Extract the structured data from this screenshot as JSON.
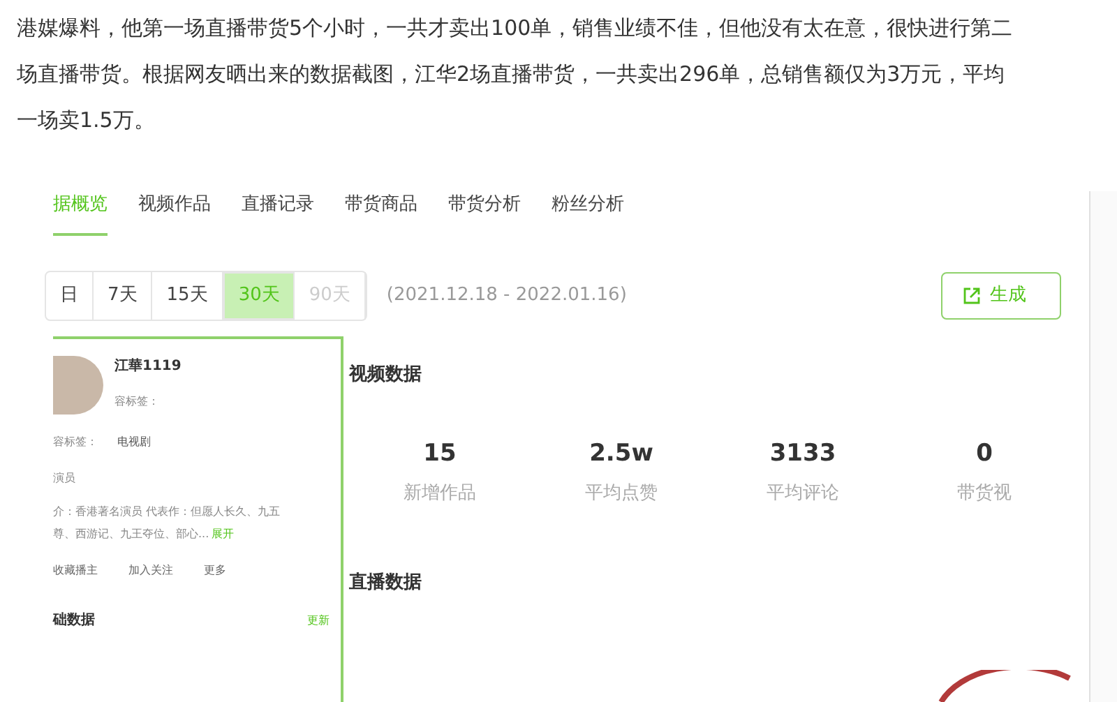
{
  "article": {
    "paragraph": "港媒爆料，他第一场直播带货5个小时，一共才卖出100单，销售业绩不佳，但他没有太在意，很快进行第二场直播带货。根据网友晒出来的数据截图，江华2场直播带货，一共卖出296单，总销售额仅为3万元，平均一场卖1.5万。"
  },
  "tabs": [
    {
      "label": "据概览",
      "selected": true
    },
    {
      "label": "视频作品",
      "selected": false
    },
    {
      "label": "直播记录",
      "selected": false
    },
    {
      "label": "带货商品",
      "selected": false
    },
    {
      "label": "带货分析",
      "selected": false
    },
    {
      "label": "粉丝分析",
      "selected": false
    }
  ],
  "ranges": [
    {
      "label": "日",
      "selected": false,
      "disabled": false
    },
    {
      "label": "7天",
      "selected": false,
      "disabled": false
    },
    {
      "label": "15天",
      "selected": false,
      "disabled": false
    },
    {
      "label": "30天",
      "selected": true,
      "disabled": false
    },
    {
      "label": "90天",
      "selected": false,
      "disabled": true
    }
  ],
  "date_range": "(2021.12.18 - 2022.01.16)",
  "generate_button": "生成",
  "profile": {
    "name": "江華1119",
    "sub_label": "容标签：",
    "tag_label": "容标签：",
    "tag_value": "电视剧",
    "role": "演员",
    "bio": "介：香港著名演员 代表作：但愿人长久、九五",
    "bio_2": "尊、西游记、九王夺位、部心...",
    "expand": "展开",
    "actions": [
      "收藏播主",
      "加入关注",
      "更多"
    ],
    "footer_title": "础数据",
    "footer_link": "更新"
  },
  "video_section": {
    "title": "视频数据",
    "stats": [
      {
        "value": "15",
        "label": "新增作品"
      },
      {
        "value": "2.5w",
        "label": "平均点赞"
      },
      {
        "value": "3133",
        "label": "平均评论"
      },
      {
        "value": "0",
        "label": "带货视"
      }
    ]
  },
  "live_section": {
    "title": "直播数据"
  }
}
